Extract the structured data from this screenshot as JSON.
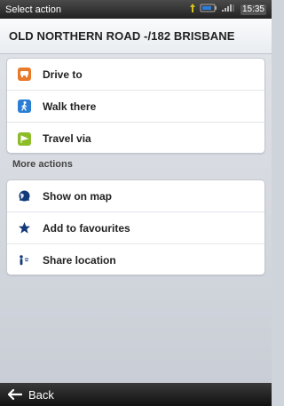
{
  "statusbar": {
    "title": "Select action",
    "time": "15:35",
    "icons": [
      "signal-icon",
      "battery-icon",
      "cellular-signal-icon"
    ]
  },
  "address": "OLD NORTHERN ROAD -/182  BRISBANE",
  "primary_actions": [
    {
      "label": "Drive to",
      "icon": "car-icon",
      "color": "#e97a2a"
    },
    {
      "label": "Walk there",
      "icon": "walk-icon",
      "color": "#2a7fd4"
    },
    {
      "label": "Travel via",
      "icon": "travel-via-icon",
      "color": "#8cbc27"
    }
  ],
  "section_label": "More actions",
  "more_actions": [
    {
      "label": "Show on map",
      "icon": "globe-icon"
    },
    {
      "label": "Add to favourites",
      "icon": "star-icon"
    },
    {
      "label": "Share location",
      "icon": "share-icon"
    }
  ],
  "footer": {
    "back_label": "Back"
  }
}
